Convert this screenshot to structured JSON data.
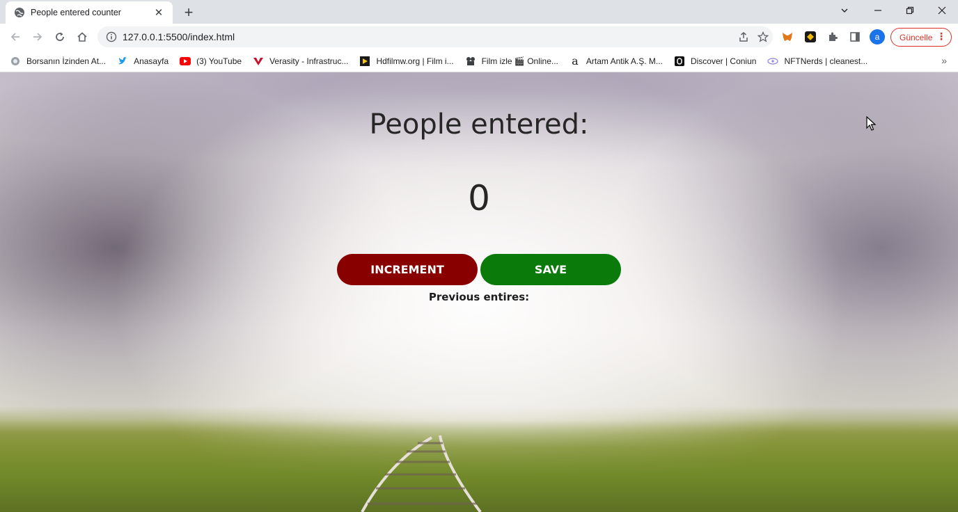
{
  "browser": {
    "tab": {
      "title": "People entered counter",
      "close": "✕"
    },
    "new_tab": "+",
    "window_controls": {
      "minimize": "—",
      "maximize": "❐",
      "close": "✕",
      "tab_search": "⌄"
    },
    "url": "127.0.0.1:5500/index.html",
    "profile_initial": "a",
    "update_button": "Güncelle",
    "accent_color": "#d93025"
  },
  "bookmarks": [
    {
      "label": "Borsanın İzinden At...",
      "icon": "globe-icon"
    },
    {
      "label": "Anasayfa",
      "icon": "twitter-icon"
    },
    {
      "label": "(3) YouTube",
      "icon": "youtube-icon"
    },
    {
      "label": "Verasity - Infrastruc...",
      "icon": "verasity-icon"
    },
    {
      "label": "Hdfilmw.org | Film i...",
      "icon": "play-icon"
    },
    {
      "label": "Film izle 🎬 Online...",
      "icon": "film-icon"
    },
    {
      "label": "Artam Antik A.Ş. M...",
      "icon": "artam-icon"
    },
    {
      "label": "Discover | Coniun",
      "icon": "coniun-icon"
    },
    {
      "label": "NFTNerds | cleanest...",
      "icon": "nftnerds-icon"
    }
  ],
  "bookmarks_more": "»",
  "app": {
    "heading": "People entered:",
    "count": "0",
    "increment_label": "INCREMENT",
    "save_label": "SAVE",
    "previous_label": "Previous entires:",
    "increment_color": "#880000",
    "save_color": "#0a7a0a"
  }
}
